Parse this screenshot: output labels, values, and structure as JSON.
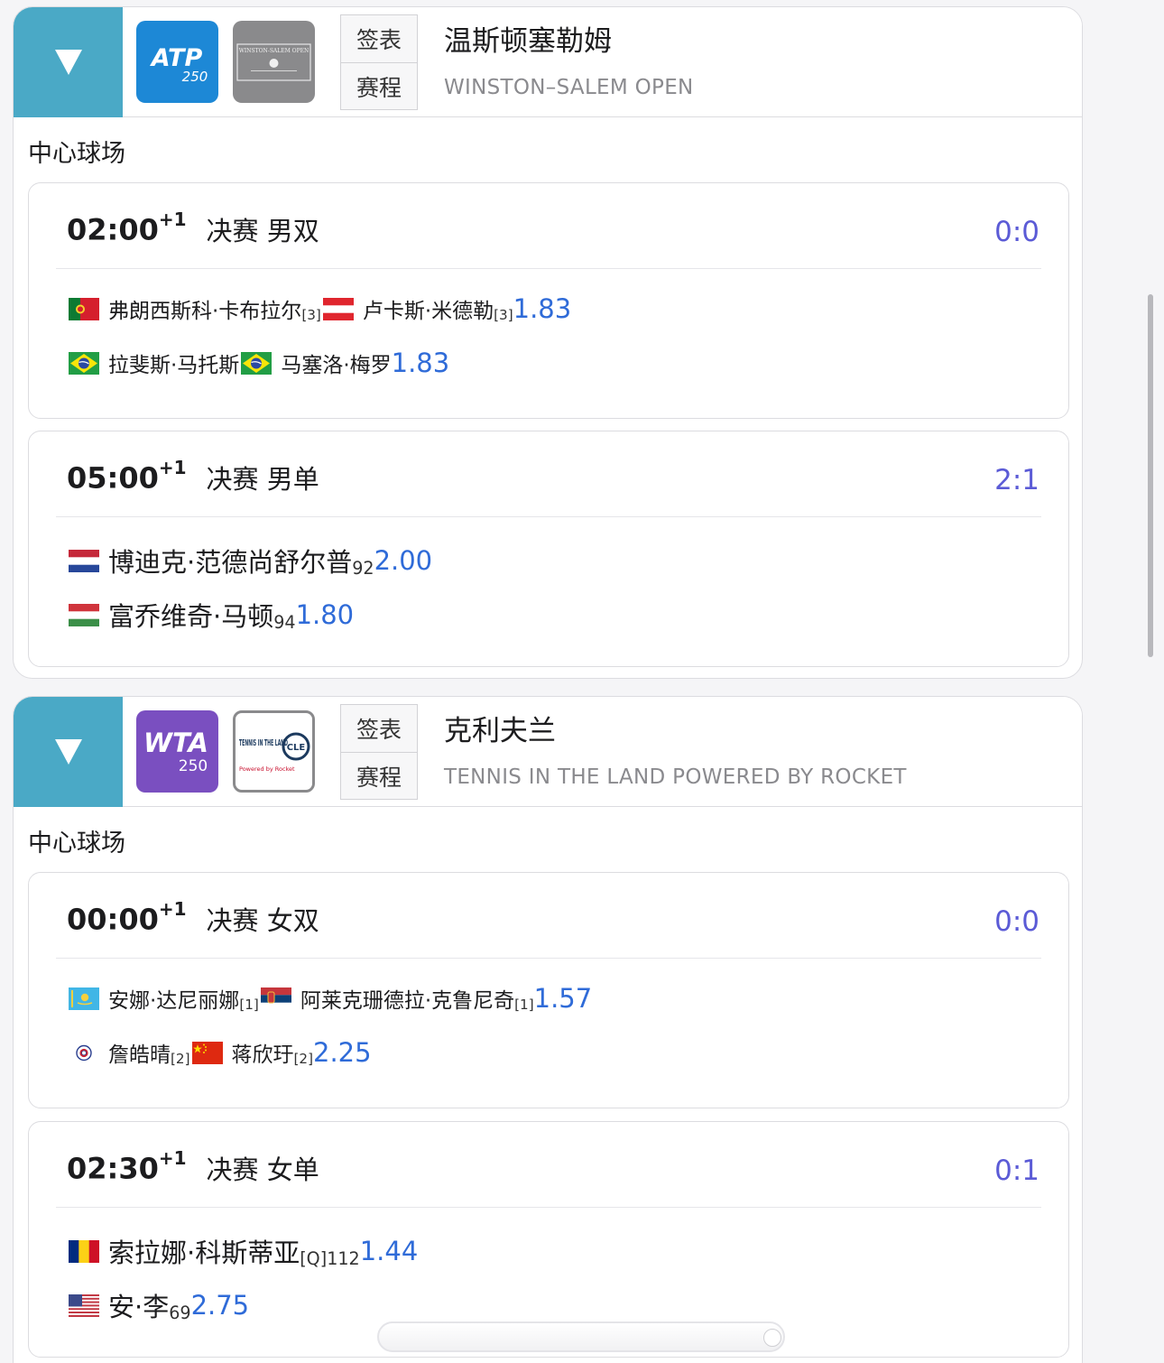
{
  "tournaments": [
    {
      "tour": "ATP",
      "level": "250",
      "name": "温斯顿塞勒姆",
      "subtitle": "WINSTON–SALEM OPEN",
      "logo2_text": "WINSTON-SALEM OPEN",
      "draw_label": "签表",
      "schedule_label": "赛程",
      "court": "中心球场",
      "matches": [
        {
          "time": "02:00",
          "day_offset": "+1",
          "round": "决赛 男双",
          "score": "0:0",
          "teams": [
            {
              "p1": "弗朗西斯科·卡布拉尔",
              "s1": "[3]",
              "f1": "portugal-flag-icon",
              "p2": "卢卡斯·米德勒",
              "s2": "[3]",
              "f2": "austria-flag-icon",
              "odds": "1.83"
            },
            {
              "p1": "拉斐斯·马托斯",
              "s1": "",
              "f1": "brazil-flag-icon",
              "p2": "马塞洛·梅罗",
              "s2": "",
              "f2": "brazil-flag-icon",
              "odds": "1.83"
            }
          ]
        },
        {
          "time": "05:00",
          "day_offset": "+1",
          "round": "决赛 男单",
          "score": "2:1",
          "players": [
            {
              "name": "博迪克·范德尚舒尔普",
              "rank": "92",
              "flag": "netherlands-flag-icon",
              "odds": "2.00"
            },
            {
              "name": "富乔维奇·马顿",
              "rank": "94",
              "flag": "hungary-flag-icon",
              "odds": "1.80"
            }
          ]
        }
      ]
    },
    {
      "tour": "WTA",
      "level": "250",
      "name": "克利夫兰",
      "subtitle": "TENNIS IN THE LAND POWERED BY ROCKET",
      "logo2_text": "TENNIS IN THE LAND",
      "logo2_badge": "CLE",
      "logo2_sub": "Powered by Rocket",
      "draw_label": "签表",
      "schedule_label": "赛程",
      "court": "中心球场",
      "matches": [
        {
          "time": "00:00",
          "day_offset": "+1",
          "round": "决赛 女双",
          "score": "0:0",
          "teams": [
            {
              "p1": "安娜·达尼丽娜",
              "s1": "[1]",
              "f1": "kazakhstan-flag-icon",
              "p2": "阿莱克珊德拉·克鲁尼奇",
              "s2": "[1]",
              "f2": "serbia-flag-icon",
              "odds": "1.57"
            },
            {
              "p1": "詹皓晴",
              "s1": "[2]",
              "f1": "chinese-taipei-flag-icon",
              "p2": "蒋欣玗",
              "s2": "[2]",
              "f2": "china-flag-icon",
              "odds": "2.25"
            }
          ]
        },
        {
          "time": "02:30",
          "day_offset": "+1",
          "round": "决赛 女单",
          "score": "0:1",
          "players": [
            {
              "name": "索拉娜·科斯蒂亚",
              "rank": "[Q]112",
              "flag": "romania-flag-icon",
              "odds": "1.44"
            },
            {
              "name": "安·李",
              "rank": "69",
              "flag": "usa-flag-icon",
              "odds": "2.75"
            }
          ]
        }
      ]
    }
  ],
  "colors": {
    "toggle_bg": "#4aa9c6",
    "atp_logo": "#1d88d6",
    "wta_logo": "#7a4fc0",
    "score": "#5b5bd6",
    "odds": "#2f6bd8"
  }
}
